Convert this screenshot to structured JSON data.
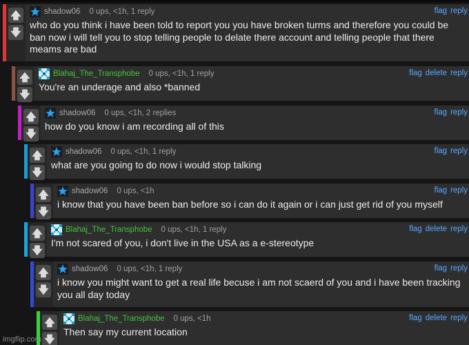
{
  "colors": {
    "red": "#e03535",
    "brown": "#8a5240",
    "magenta": "#c21fc9",
    "cyan": "#1c9ad6",
    "indigo": "#3d43d1",
    "cyan2": "#1aa3e0",
    "blue": "#3049d8",
    "green": "#36d43a",
    "link": "#56a8ff",
    "username_green": "#45c23c"
  },
  "vote_icons": {
    "up": "up-arrow-icon",
    "down": "down-arrow-icon"
  },
  "links": {
    "flag": "flag",
    "delete": "delete",
    "reply": "reply"
  },
  "comments": [
    {
      "user": "shadow06",
      "avatar": "star-icon",
      "meta": "0 ups, <1h, 1 reply",
      "text": "who do you think i have been told to report you you have broken turms and therefore you could be ban now i will tell you to stop telling people to delate there account and telling people that there meams are bad",
      "bar": "red",
      "show_delete": false
    },
    {
      "user": "Blahaj_The_Transphobe",
      "avatar": "pixel-x-icon",
      "meta": "0 ups, <1h, 1 reply",
      "text": "You're an underage and also *banned",
      "bar": "brown",
      "show_delete": true
    },
    {
      "user": "shadow06",
      "avatar": "star-icon",
      "meta": "0 ups, <1h, 2 replies",
      "text": "how do you know i am recording all of this",
      "bar": "magenta",
      "show_delete": false
    },
    {
      "user": "shadow06",
      "avatar": "star-icon",
      "meta": "0 ups, <1h, 1 reply",
      "text": "what are you going to do now i would stop talking",
      "bar": "cyan",
      "show_delete": false
    },
    {
      "user": "shadow06",
      "avatar": "star-icon",
      "meta": "0 ups, <1h",
      "text": "i know that you have been ban before so i can do it again or i can just get rid of you myself",
      "bar": "indigo",
      "show_delete": false
    },
    {
      "user": "Blahaj_The_Transphobe",
      "avatar": "pixel-x-icon",
      "meta": "0 ups, <1h, 1 reply",
      "text": "I'm not scared of you, i don't live in the USA as a e-stereotype",
      "bar": "cyan2",
      "show_delete": true
    },
    {
      "user": "shadow06",
      "avatar": "star-icon",
      "meta": "0 ups, <1h, 1 reply",
      "text": "i know you might want to get a real life becuse i am not scaerd of you and i have been tracking you all day today",
      "bar": "blue",
      "show_delete": false
    },
    {
      "user": "Blahaj_The_Transphobe",
      "avatar": "pixel-x-icon",
      "meta": "0 ups, <1h",
      "text": "Then say my current location",
      "bar": "green",
      "show_delete": true
    }
  ],
  "watermark": "imgflip.com"
}
